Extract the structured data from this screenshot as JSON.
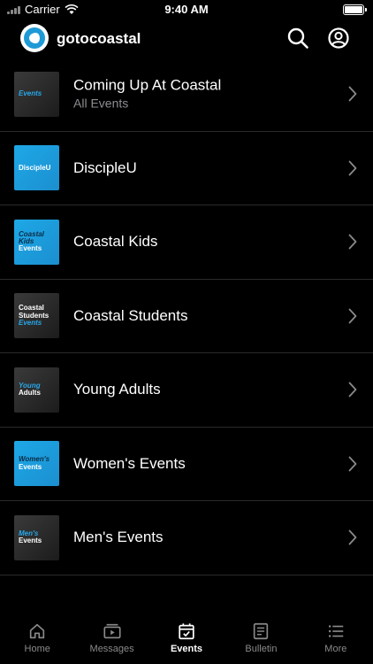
{
  "status_bar": {
    "carrier": "Carrier",
    "time": "9:40 AM"
  },
  "header": {
    "app_name": "gotocoastal"
  },
  "events": [
    {
      "title": "Coming Up At Coastal",
      "subtitle": "All Events",
      "thumb_lines": [
        "Events"
      ],
      "thumb_style": "dark"
    },
    {
      "title": "DiscipleU",
      "subtitle": "",
      "thumb_lines": [
        "DiscipleU"
      ],
      "thumb_style": "blue"
    },
    {
      "title": "Coastal Kids",
      "subtitle": "",
      "thumb_lines": [
        "Coastal",
        "Kids",
        "Events"
      ],
      "thumb_style": "blue"
    },
    {
      "title": "Coastal Students",
      "subtitle": "",
      "thumb_lines": [
        "Coastal",
        "Students",
        "Events"
      ],
      "thumb_style": "dark"
    },
    {
      "title": "Young Adults",
      "subtitle": "",
      "thumb_lines": [
        "Young",
        "Adults"
      ],
      "thumb_style": "dark"
    },
    {
      "title": "Women's Events",
      "subtitle": "",
      "thumb_lines": [
        "Women's",
        "Events"
      ],
      "thumb_style": "blue"
    },
    {
      "title": "Men's Events",
      "subtitle": "",
      "thumb_lines": [
        "Men's",
        "Events"
      ],
      "thumb_style": "dark"
    }
  ],
  "tabs": [
    {
      "label": "Home",
      "icon": "home-icon",
      "active": false
    },
    {
      "label": "Messages",
      "icon": "messages-icon",
      "active": false
    },
    {
      "label": "Events",
      "icon": "calendar-icon",
      "active": true
    },
    {
      "label": "Bulletin",
      "icon": "bulletin-icon",
      "active": false
    },
    {
      "label": "More",
      "icon": "list-icon",
      "active": false
    }
  ],
  "colors": {
    "accent": "#1ea8e6",
    "background": "#000000",
    "muted_text": "#8e8e93",
    "tab_inactive": "#8a8a8a"
  }
}
